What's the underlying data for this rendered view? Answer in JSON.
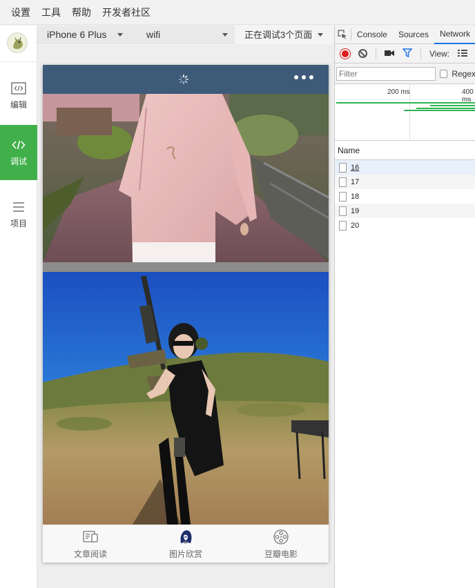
{
  "menu": {
    "items": [
      "设置",
      "工具",
      "帮助",
      "开发者社区"
    ]
  },
  "sidebar": {
    "items": [
      {
        "label": "编辑",
        "icon": "code-editor-icon"
      },
      {
        "label": "调试",
        "icon": "code-icon",
        "active": true
      },
      {
        "label": "项目",
        "icon": "menu-lines-icon"
      }
    ]
  },
  "simulator": {
    "device": "iPhone 6 Plus",
    "network": "wifi",
    "pages": "正在调试3个页面"
  },
  "app": {
    "tabs": [
      {
        "label": "文章阅读",
        "icon": "article-icon"
      },
      {
        "label": "图片欣赏",
        "icon": "portrait-icon"
      },
      {
        "label": "豆瓣电影",
        "icon": "film-reel-icon"
      }
    ]
  },
  "devtools": {
    "tabs": [
      "Console",
      "Sources",
      "Network"
    ],
    "active_tab": "Network",
    "view_label": "View:",
    "filter_placeholder": "Filter",
    "regex_label": "Regex",
    "timeline_labels": [
      "200 ms",
      "400 ms"
    ],
    "column_name": "Name",
    "requests": [
      "16",
      "17",
      "18",
      "19",
      "20"
    ]
  },
  "colors": {
    "accent_green": "#41b04a",
    "navbar": "#3e5a79",
    "record": "#e01b1b"
  }
}
